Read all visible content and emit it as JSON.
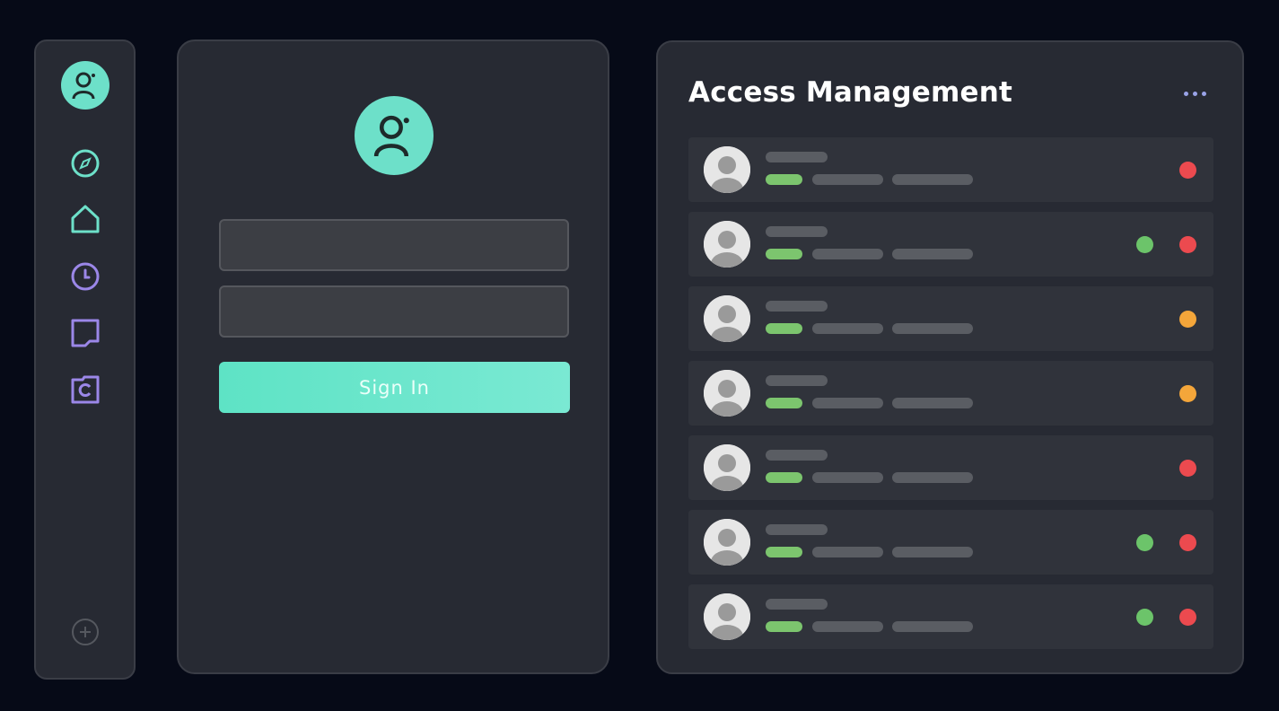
{
  "sidebar": {
    "items": [
      {
        "id": "profile",
        "icon": "user-avatar-icon"
      },
      {
        "id": "discover",
        "icon": "compass-icon"
      },
      {
        "id": "home",
        "icon": "home-icon"
      },
      {
        "id": "history",
        "icon": "clock-icon"
      },
      {
        "id": "notes",
        "icon": "note-icon"
      },
      {
        "id": "refresh",
        "icon": "refresh-document-icon"
      }
    ],
    "add_icon": "plus-circle-icon"
  },
  "login": {
    "avatar_icon": "user-avatar-icon",
    "username": {
      "value": "",
      "placeholder": ""
    },
    "password": {
      "value": "",
      "placeholder": ""
    },
    "sign_in_label": "Sign In"
  },
  "access": {
    "title": "Access Management",
    "more_icon": "more-horizontal-icon",
    "users": [
      {
        "status": [
          "red"
        ]
      },
      {
        "status": [
          "green",
          "red"
        ]
      },
      {
        "status": [
          "orange"
        ]
      },
      {
        "status": [
          "orange"
        ]
      },
      {
        "status": [
          "red"
        ]
      },
      {
        "status": [
          "green",
          "red"
        ]
      },
      {
        "status": [
          "green",
          "red"
        ]
      }
    ]
  },
  "colors": {
    "background": "#060a17",
    "panel": "#272a33",
    "accent": "#6de0c9",
    "secondary_accent": "#9b87e8",
    "status_green": "#6cc46a",
    "status_red": "#ec4a4f",
    "status_orange": "#f4a63a"
  }
}
